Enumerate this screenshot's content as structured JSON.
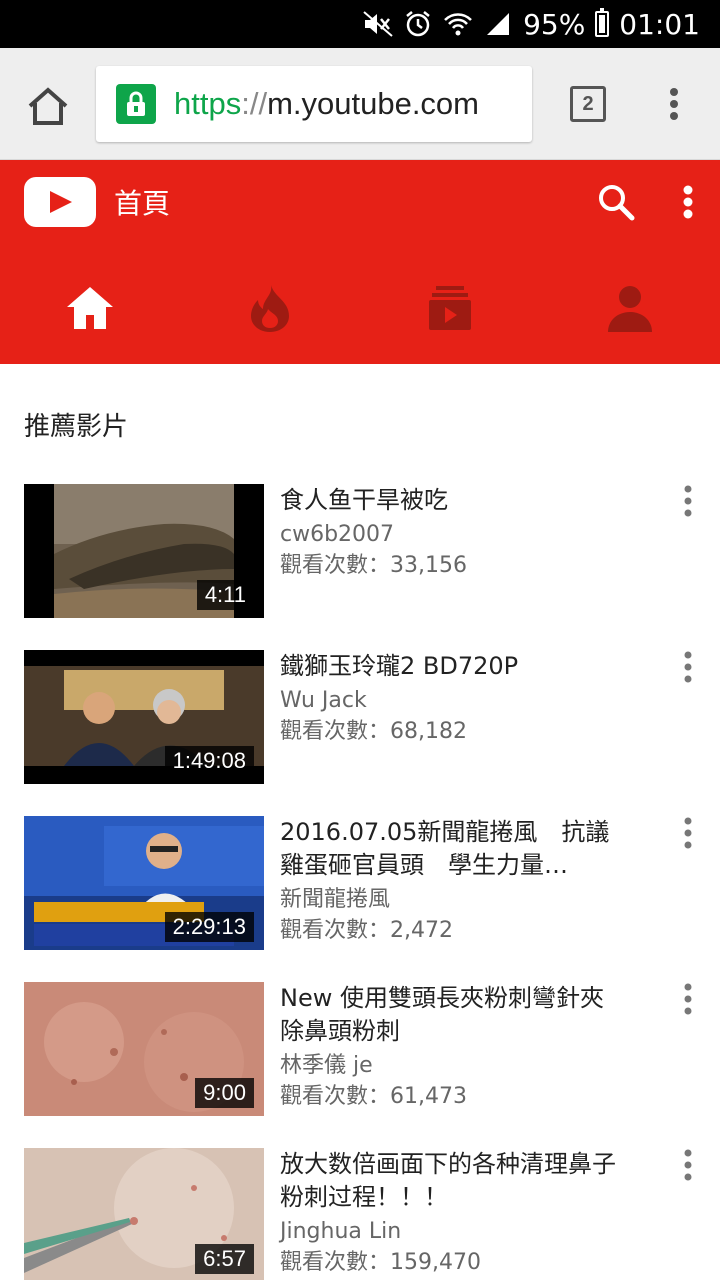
{
  "status_bar": {
    "battery_text": "95%",
    "time": "01:01",
    "icons": [
      "mute-icon",
      "alarm-icon",
      "wifi-icon",
      "signal-icon",
      "battery-icon"
    ]
  },
  "browser": {
    "url_scheme": "https",
    "url_slashes": "://",
    "url_host": "m.youtube.com",
    "tab_count": "2"
  },
  "youtube": {
    "page_title": "首頁",
    "brand_color": "#e62117",
    "nav": [
      "home-icon",
      "trending-icon",
      "subscriptions-icon",
      "account-icon"
    ]
  },
  "section_title": "推薦影片",
  "videos": [
    {
      "title": "食人鱼干旱被吃",
      "channel": "cw6b2007",
      "views": "觀看次數：33,156",
      "duration": "4:11"
    },
    {
      "title": "鐵獅玉玲瓏2 BD720P",
      "channel": "Wu Jack",
      "views": "觀看次數：68,182",
      "duration": "1:49:08"
    },
    {
      "title": "2016.07.05新聞龍捲風　抗議雞蛋砸官員頭　學生力量…",
      "channel": "新聞龍捲風",
      "views": "觀看次數：2,472",
      "duration": "2:29:13"
    },
    {
      "title": "New 使用雙頭長夾粉刺彎針夾除鼻頭粉刺",
      "channel": "林季儀 je",
      "views": "觀看次數：61,473",
      "duration": "9:00"
    },
    {
      "title": "放大数倍画面下的各种清理鼻子粉刺过程！！！",
      "channel": "Jinghua Lin",
      "views": "觀看次數：159,470",
      "duration": "6:57"
    }
  ]
}
